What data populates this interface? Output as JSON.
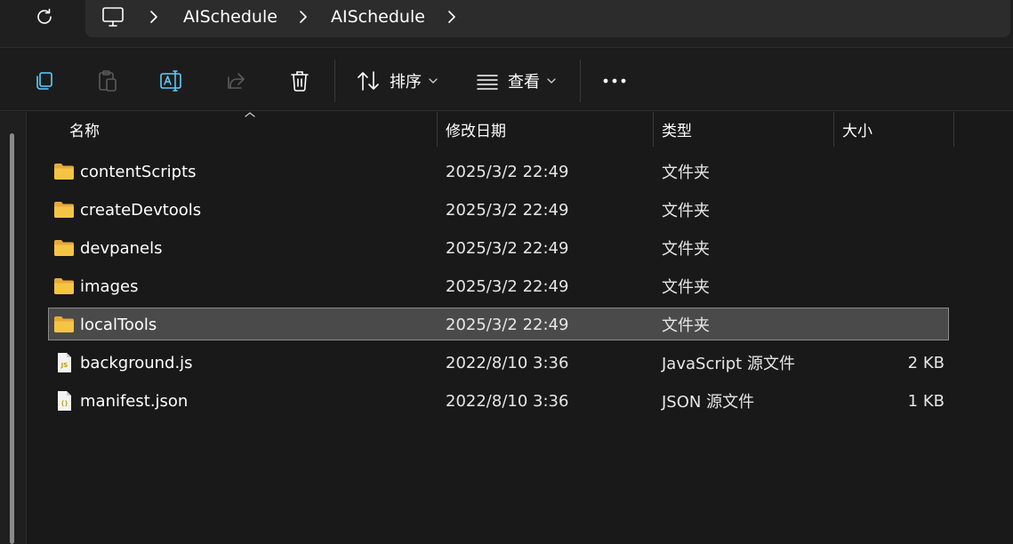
{
  "breadcrumb": {
    "items": [
      "AISchedule",
      "AISchedule"
    ]
  },
  "toolbar": {
    "sort_label": "排序",
    "view_label": "查看"
  },
  "columns": {
    "name": "名称",
    "modified": "修改日期",
    "type": "类型",
    "size": "大小"
  },
  "files": [
    {
      "name": "contentScripts",
      "modified": "2025/3/2 22:49",
      "type": "文件夹",
      "size": "",
      "icon": "folder-icon"
    },
    {
      "name": "createDevtools",
      "modified": "2025/3/2 22:49",
      "type": "文件夹",
      "size": "",
      "icon": "folder-icon"
    },
    {
      "name": "devpanels",
      "modified": "2025/3/2 22:49",
      "type": "文件夹",
      "size": "",
      "icon": "folder-icon"
    },
    {
      "name": "images",
      "modified": "2025/3/2 22:49",
      "type": "文件夹",
      "size": "",
      "icon": "folder-icon"
    },
    {
      "name": "localTools",
      "modified": "2025/3/2 22:49",
      "type": "文件夹",
      "size": "",
      "icon": "folder-icon",
      "selected": true
    },
    {
      "name": "background.js",
      "modified": "2022/8/10 3:36",
      "type": "JavaScript 源文件",
      "size": "2 KB",
      "icon": "js-file-icon"
    },
    {
      "name": "manifest.json",
      "modified": "2022/8/10 3:36",
      "type": "JSON 源文件",
      "size": "1 KB",
      "icon": "json-file-icon"
    }
  ],
  "colors": {
    "folder": "#f6c445",
    "selected_row": "#4a4a4a",
    "background": "#191919"
  }
}
